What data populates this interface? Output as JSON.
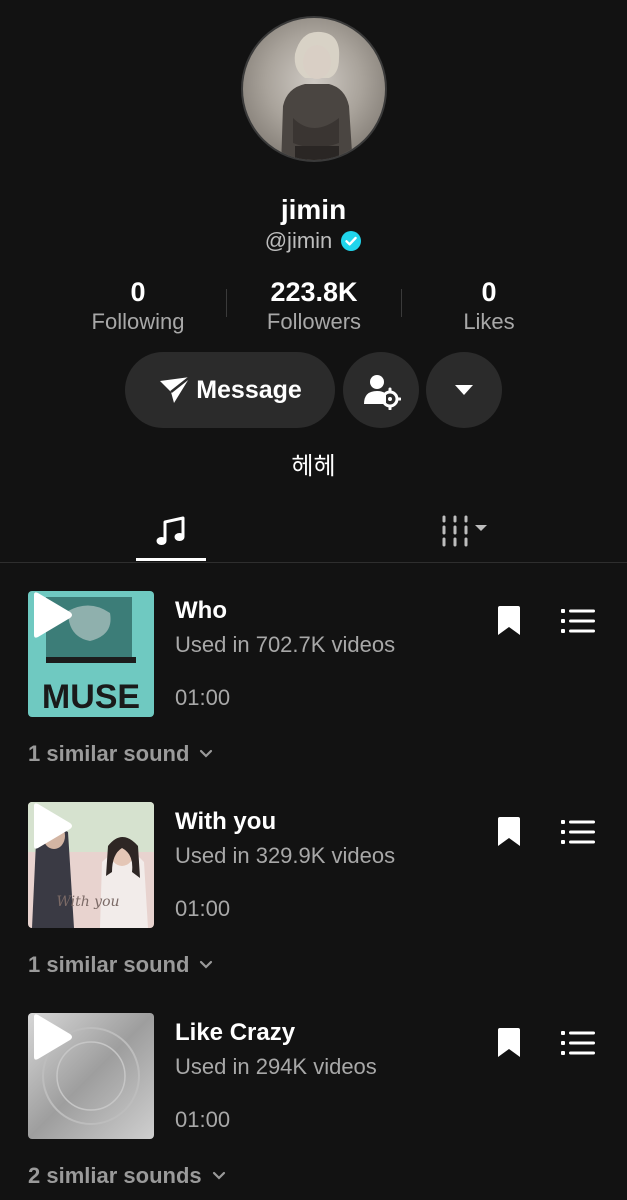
{
  "profile": {
    "display_name": "jimin",
    "handle": "@jimin",
    "verified": true,
    "bio": "헤헤"
  },
  "stats": [
    {
      "value": "0",
      "label": "Following"
    },
    {
      "value": "223.8K",
      "label": "Followers"
    },
    {
      "value": "0",
      "label": "Likes"
    }
  ],
  "actions": {
    "message_label": "Message"
  },
  "tabs": [
    {
      "icon": "music-note-icon",
      "active": true
    },
    {
      "icon": "filter-sliders-icon",
      "active": false
    }
  ],
  "sounds": [
    {
      "title": "Who",
      "usage": "Used in 702.7K videos",
      "duration": "01:00",
      "similar": "1 similar sound",
      "cover_text": "MUSE"
    },
    {
      "title": "With you",
      "usage": "Used in 329.9K videos",
      "duration": "01:00",
      "similar": "1 similar sound",
      "cover_text": "With you"
    },
    {
      "title": "Like Crazy",
      "usage": "Used in 294K videos",
      "duration": "01:00",
      "similar": "2 simliar sounds",
      "cover_text": ""
    }
  ],
  "colors": {
    "background": "#121212",
    "button": "#2b2b2b",
    "verified": "#20d5ec",
    "muted_text": "#a8a8a8"
  }
}
